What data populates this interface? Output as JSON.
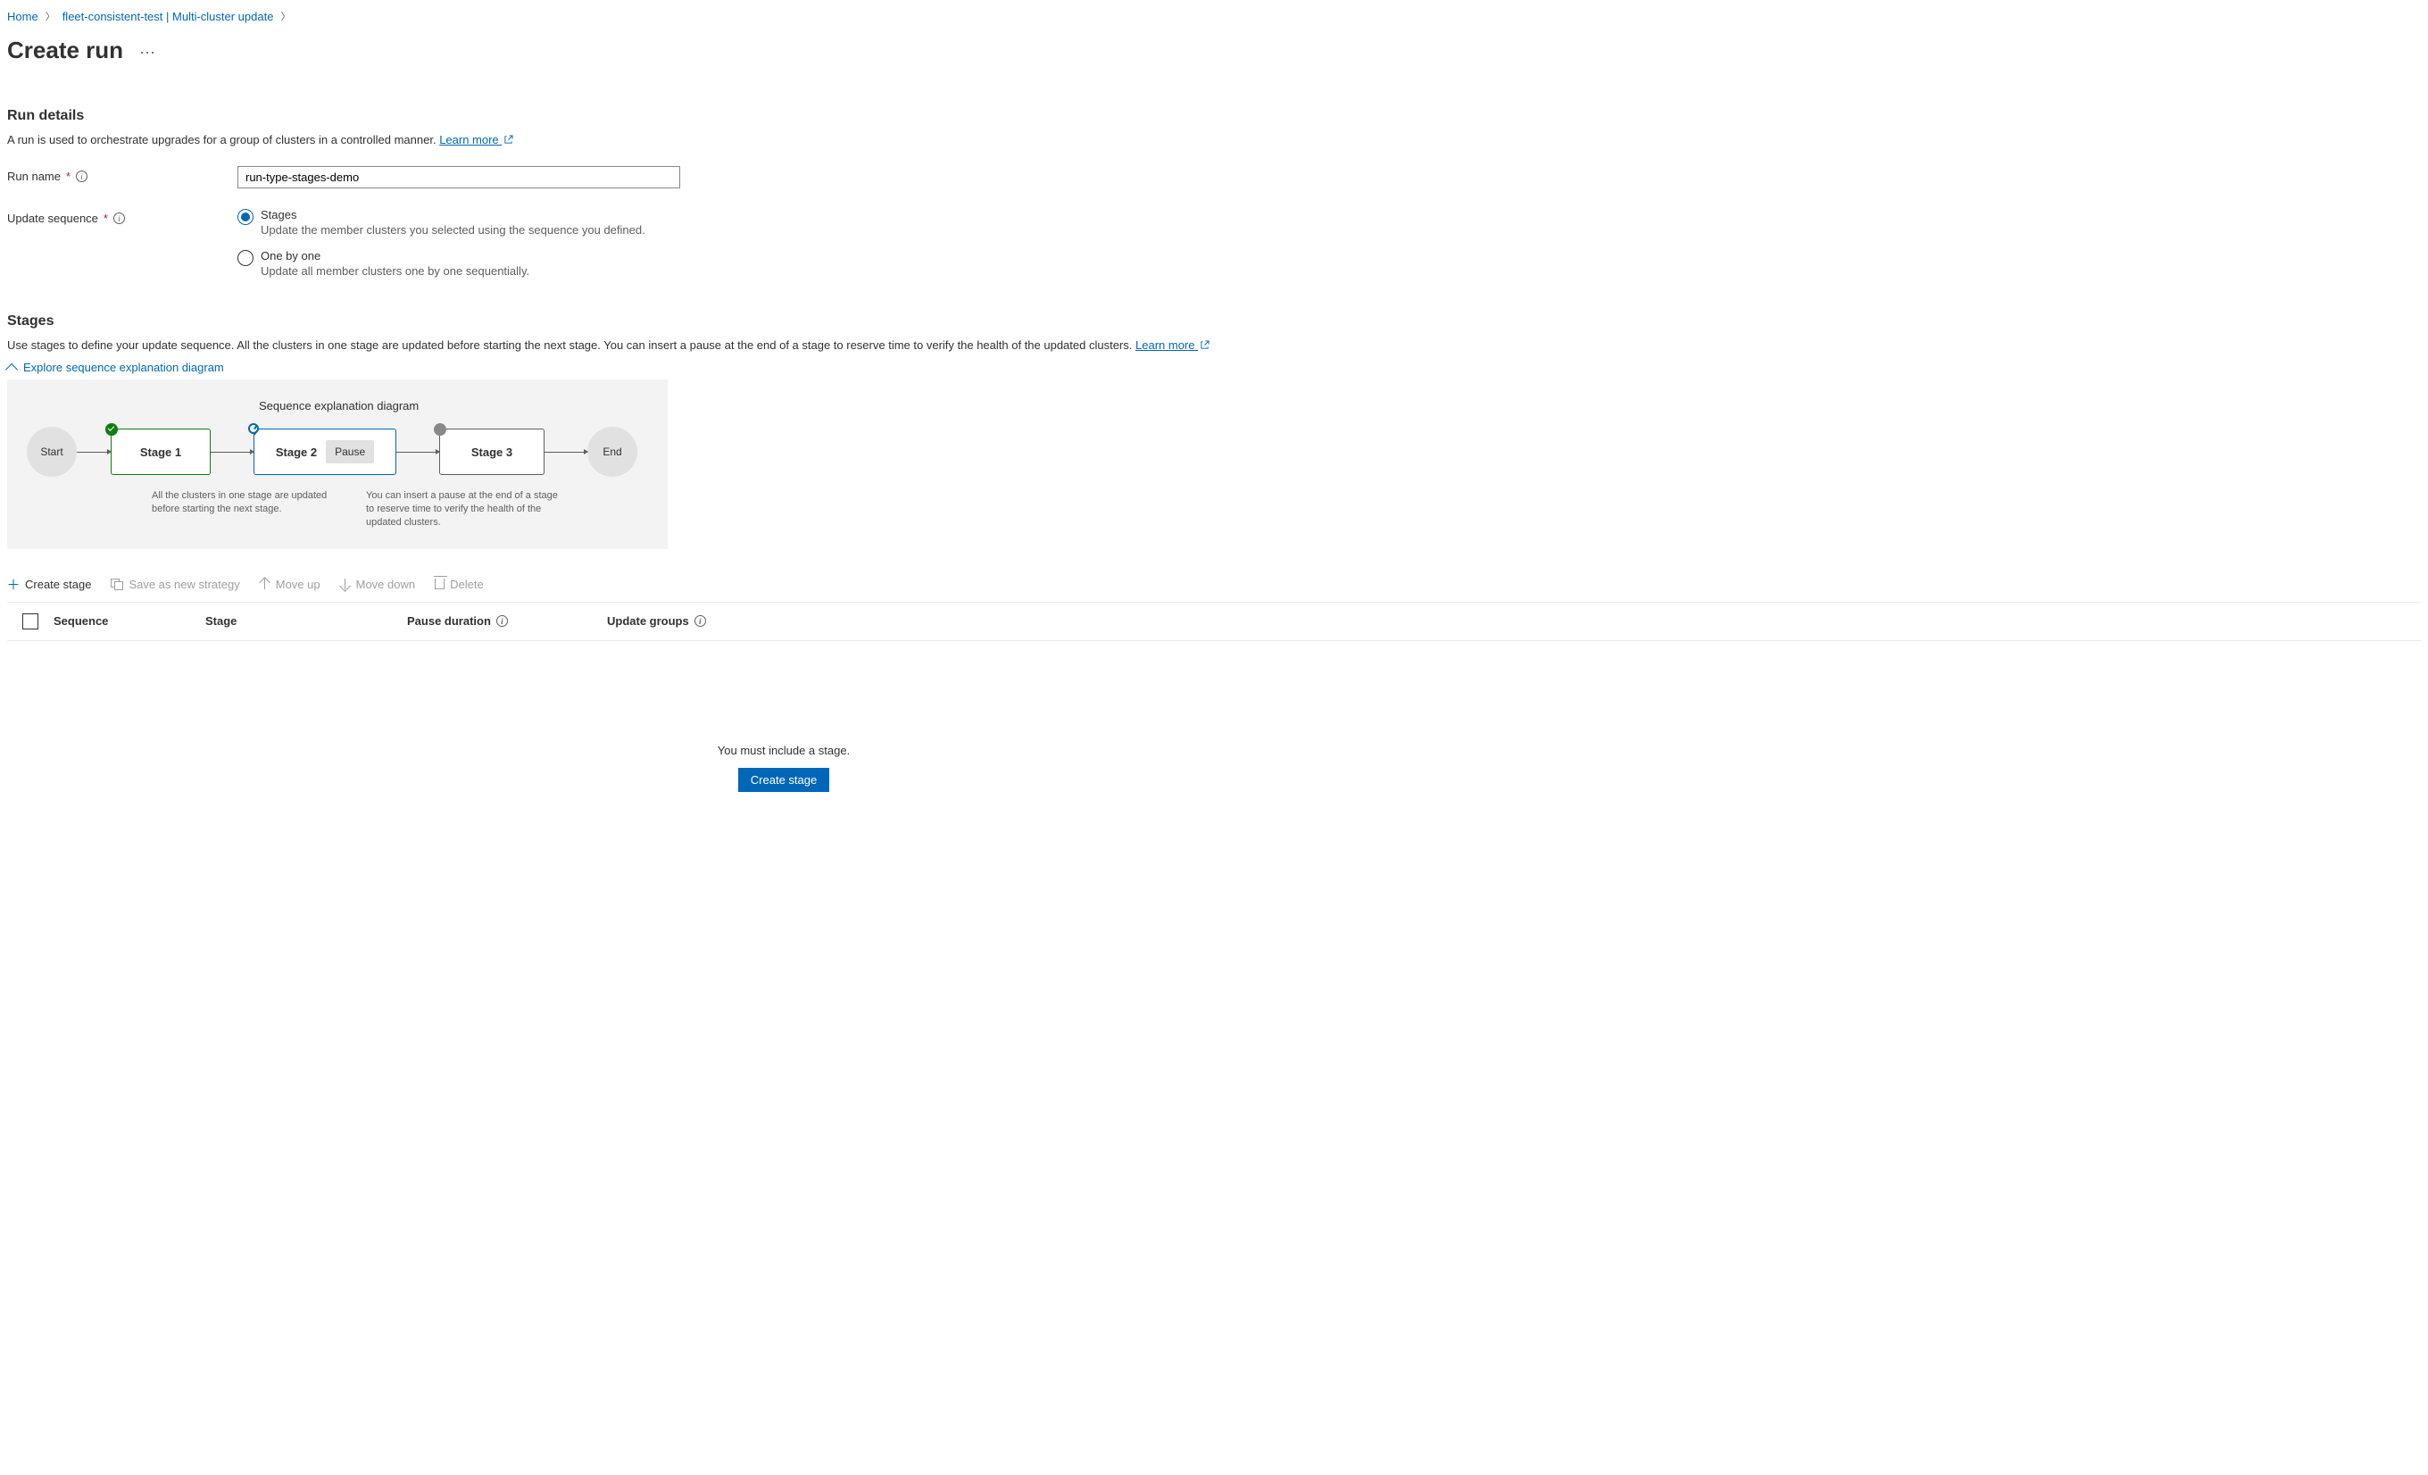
{
  "breadcrumb": {
    "items": [
      "Home",
      "fleet-consistent-test | Multi-cluster update"
    ]
  },
  "page": {
    "title": "Create run"
  },
  "sections": {
    "runDetails": {
      "heading": "Run details",
      "description": "A run is used to orchestrate upgrades for a group of clusters in a controlled manner.",
      "learnMore": "Learn more",
      "runName": {
        "label": "Run name",
        "value": "run-type-stages-demo"
      },
      "updateSequence": {
        "label": "Update sequence",
        "options": [
          {
            "title": "Stages",
            "sub": "Update the member clusters you selected using the sequence you defined.",
            "selected": true
          },
          {
            "title": "One by one",
            "sub": "Update all member clusters one by one sequentially.",
            "selected": false
          }
        ]
      }
    },
    "stages": {
      "heading": "Stages",
      "description": "Use stages to define your update sequence. All the clusters in one stage are updated before starting the next stage. You can insert a pause at the end of a stage to reserve time to verify the health of the updated clusters.",
      "learnMore": "Learn more",
      "expandLabel": "Explore sequence explanation diagram",
      "diagram": {
        "title": "Sequence explanation diagram",
        "start": "Start",
        "stage1": "Stage 1",
        "stage2": "Stage 2",
        "pause": "Pause",
        "stage3": "Stage 3",
        "end": "End",
        "caption1": "All the clusters in one stage are updated before starting the next stage.",
        "caption2": "You can insert a pause at the end of a stage to reserve time to verify the health of the updated clusters."
      },
      "toolbar": {
        "createStage": "Create stage",
        "saveAsNew": "Save as new strategy",
        "moveUp": "Move up",
        "moveDown": "Move down",
        "delete": "Delete"
      },
      "table": {
        "cols": {
          "sequence": "Sequence",
          "stage": "Stage",
          "pause": "Pause duration",
          "groups": "Update groups"
        }
      },
      "empty": {
        "message": "You must include a stage.",
        "button": "Create stage"
      }
    }
  }
}
